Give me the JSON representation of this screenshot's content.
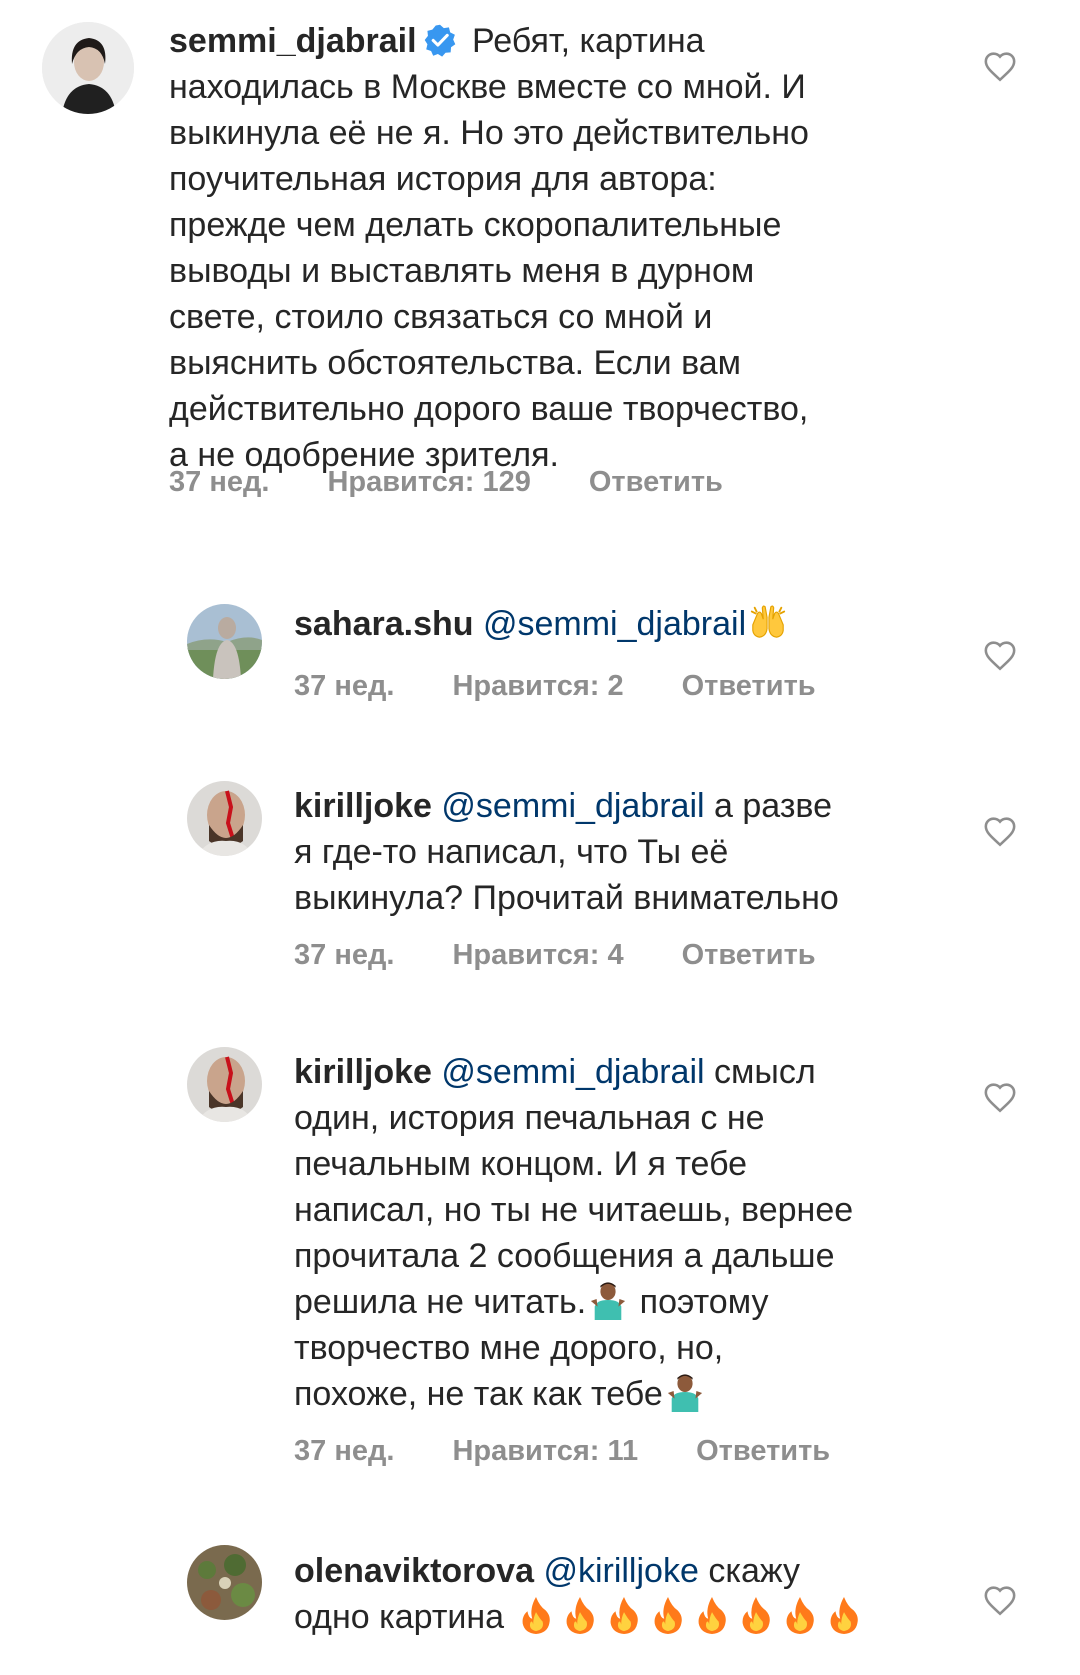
{
  "comments": [
    {
      "username": "semmi_djabrail",
      "verified": true,
      "text_lines": [
        "Ребят, картина",
        "находилась в Москве вместе со мной. И",
        "выкинула её не я. Но это действительно",
        "поучительная история для автора:",
        "прежде чем делать скоропалительные",
        "выводы и выставлять меня в дурном",
        "свете, стоило связаться со мной и",
        "выяснить обстоятельства. Если вам",
        "действительно дорого ваше творчество,",
        "а не одобрение зрителя."
      ],
      "time": "37 нед.",
      "likes": "Нравится: 129",
      "reply": "Ответить"
    },
    {
      "username": "sahara.shu",
      "mention": "@semmi_djabrail",
      "text_after_mention": "",
      "emoji": "raising-hands",
      "time": "37 нед.",
      "likes": "Нравится: 2",
      "reply": "Ответить"
    },
    {
      "username": "kirilljoke",
      "mention": "@semmi_djabrail",
      "line1_rest": "а разве",
      "text_lines": [
        "я где-то написал, что Ты её",
        "выкинула? Прочитай внимательно"
      ],
      "time": "37 нед.",
      "likes": "Нравится: 4",
      "reply": "Ответить"
    },
    {
      "username": "kirilljoke",
      "mention": "@semmi_djabrail",
      "line1_rest": "смысл",
      "text_lines": [
        "один, история печальная с не",
        "печальным концом. И я тебе",
        "написал, но ты не читаешь, вернее",
        "прочитала 2 сообщения а дальше"
      ],
      "line6_before": "решила не читать.",
      "line6_after": "поэтому",
      "line7": "творчество мне дорого, но,",
      "line8": "похоже, не так как тебе",
      "emoji": "person-shrugging",
      "time": "37 нед.",
      "likes": "Нравится: 11",
      "reply": "Ответить"
    },
    {
      "username": "olenaviktorova",
      "mention": "@kirilljoke",
      "line1_rest": "скажу",
      "line2": "одно картина",
      "emoji": "fire",
      "emoji_count": 8
    }
  ],
  "colors": {
    "text": "#262626",
    "mention": "#00376b",
    "meta": "#8e8e8e",
    "verified": "#3897f0",
    "heart_outline": "#8e8e8e"
  }
}
